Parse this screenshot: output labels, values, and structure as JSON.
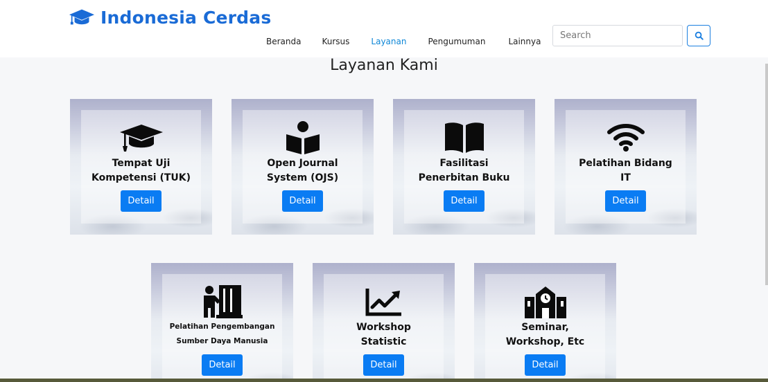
{
  "brand": {
    "name": "Indonesia Cerdas",
    "icon": "graduation-cap-icon",
    "color": "#1a6bd6"
  },
  "nav": [
    {
      "label": "Beranda",
      "active": false
    },
    {
      "label": "Kursus",
      "active": false
    },
    {
      "label": "Layanan",
      "active": true
    },
    {
      "label": "Pengumuman",
      "active": false
    },
    {
      "label": "Lainnya",
      "active": false
    }
  ],
  "search": {
    "placeholder": "Search",
    "button_icon": "search-icon"
  },
  "page_title": "Layanan Kami",
  "cards": [
    {
      "title_lines": [
        "Tempat Uji",
        "Kompetensi (TUK)"
      ],
      "icon": "graduation-cap-icon",
      "button": "Detail"
    },
    {
      "title_lines": [
        "Open Journal",
        "System (OJS)"
      ],
      "icon": "book-reader-icon",
      "button": "Detail"
    },
    {
      "title_lines": [
        "Fasilitasi",
        "Penerbitan Buku"
      ],
      "icon": "open-book-icon",
      "button": "Detail"
    },
    {
      "title_lines": [
        "Pelatihan Bidang",
        "IT"
      ],
      "icon": "wifi-icon",
      "button": "Detail"
    },
    {
      "title_lines": [
        "Pelatihan Pengembangan",
        "Sumber Daya Manusia"
      ],
      "icon": "teacher-icon",
      "button": "Detail"
    },
    {
      "title_lines": [
        "Workshop",
        "Statistic"
      ],
      "icon": "chart-line-icon",
      "button": "Detail"
    },
    {
      "title_lines": [
        "Seminar,",
        "Workshop, Etc"
      ],
      "icon": "school-icon",
      "button": "Detail"
    }
  ],
  "colors": {
    "accent": "#0a7cf3",
    "nav_active": "#0d86d6"
  }
}
